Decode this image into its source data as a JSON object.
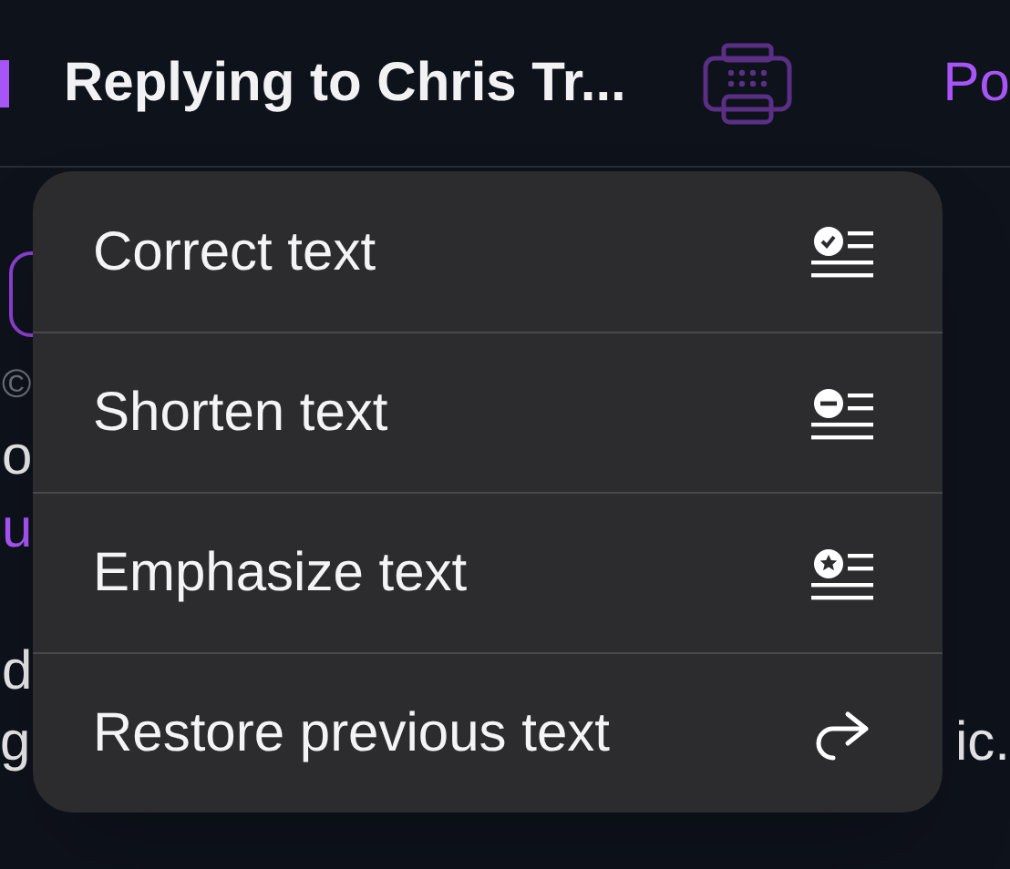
{
  "header": {
    "title": "Replying to Chris Tr...",
    "action": "Po"
  },
  "background_lines": [
    {
      "kind": "icon-button"
    },
    {
      "kind": "text",
      "text": "©",
      "color": "#6b6f78"
    },
    {
      "kind": "text",
      "text": "o",
      "color": "#e8e8ea"
    },
    {
      "kind": "text",
      "text": "u",
      "color": "#a855f7"
    },
    {
      "kind": "text",
      "text": "d",
      "color": "#e8e8ea"
    },
    {
      "kind": "split",
      "text": "g",
      "end_text": "ic."
    }
  ],
  "menu": {
    "items": [
      {
        "label": "Correct text",
        "kind": "check"
      },
      {
        "label": "Shorten text",
        "kind": "minus"
      },
      {
        "label": "Emphasize text",
        "kind": "star"
      },
      {
        "label": "Restore previous text",
        "kind": "redo"
      }
    ]
  }
}
